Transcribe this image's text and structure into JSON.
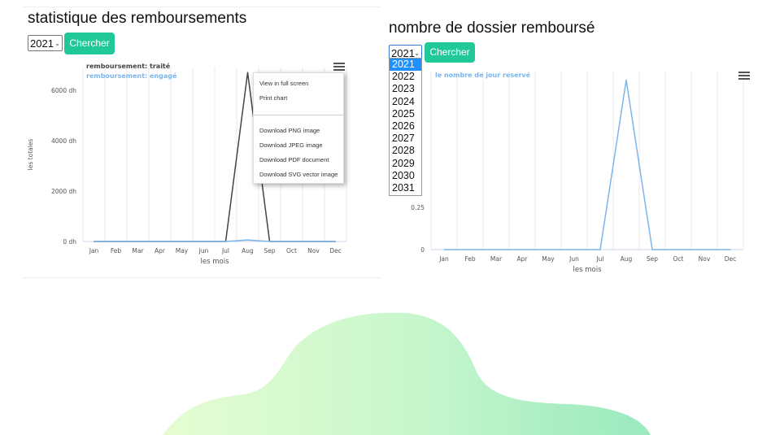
{
  "panel1": {
    "title": "statistique des remboursements",
    "year_select": "2021",
    "search_button": "Chercher",
    "context_menu": [
      "View in full screen",
      "Print chart",
      "Download PNG image",
      "Download JPEG image",
      "Download PDF document",
      "Download SVG vector image"
    ]
  },
  "panel2": {
    "title": "nombre de dossier remboursé",
    "year_select": "2021",
    "search_button": "Chercher",
    "year_options": [
      "2021",
      "2022",
      "2023",
      "2024",
      "2025",
      "2026",
      "2027",
      "2028",
      "2029",
      "2030",
      "2031"
    ],
    "selected_option": "2021"
  },
  "colors": {
    "accent": "#20c997",
    "series_dark": "#434348",
    "series_light": "#7cb5ec",
    "selected_option": "#1e90ff"
  },
  "chart_data": [
    {
      "type": "line",
      "categories": [
        "Jan",
        "Feb",
        "Mar",
        "Apr",
        "May",
        "Jun",
        "Jul",
        "Aug",
        "Sep",
        "Oct",
        "Nov",
        "Dec"
      ],
      "series": [
        {
          "name": "remboursement: traité",
          "values": [
            0,
            0,
            0,
            0,
            0,
            0,
            0,
            6700,
            0,
            0,
            0,
            0
          ],
          "color": "#434348"
        },
        {
          "name": "remboursement: engagé",
          "values": [
            0,
            0,
            0,
            0,
            0,
            0,
            0,
            60,
            0,
            0,
            0,
            0
          ],
          "color": "#7cb5ec"
        }
      ],
      "ylabel": "les totales",
      "xlabel": "les mois",
      "yticks": [
        "0 dh",
        "2000 dh",
        "4000 dh",
        "6000 dh"
      ],
      "ytick_values": [
        0,
        2000,
        4000,
        6000
      ],
      "ylim": [
        0,
        6900
      ],
      "legend": "top-left",
      "grid": "vertical"
    },
    {
      "type": "line",
      "categories": [
        "Jan",
        "Feb",
        "Mar",
        "Apr",
        "May",
        "Jun",
        "Jul",
        "Aug",
        "Sep",
        "Oct",
        "Nov",
        "Dec"
      ],
      "series": [
        {
          "name": "le nombre de jour reservé",
          "values": [
            0,
            0,
            0,
            0,
            0,
            0,
            0,
            1,
            0,
            0,
            0,
            0
          ],
          "color": "#7cb5ec"
        }
      ],
      "xlabel": "les mois",
      "yticks": [
        "0",
        "0.25"
      ],
      "ytick_values": [
        0,
        0.25
      ],
      "ylim": [
        0,
        1.05
      ],
      "legend": "top-left",
      "grid": "vertical"
    }
  ]
}
